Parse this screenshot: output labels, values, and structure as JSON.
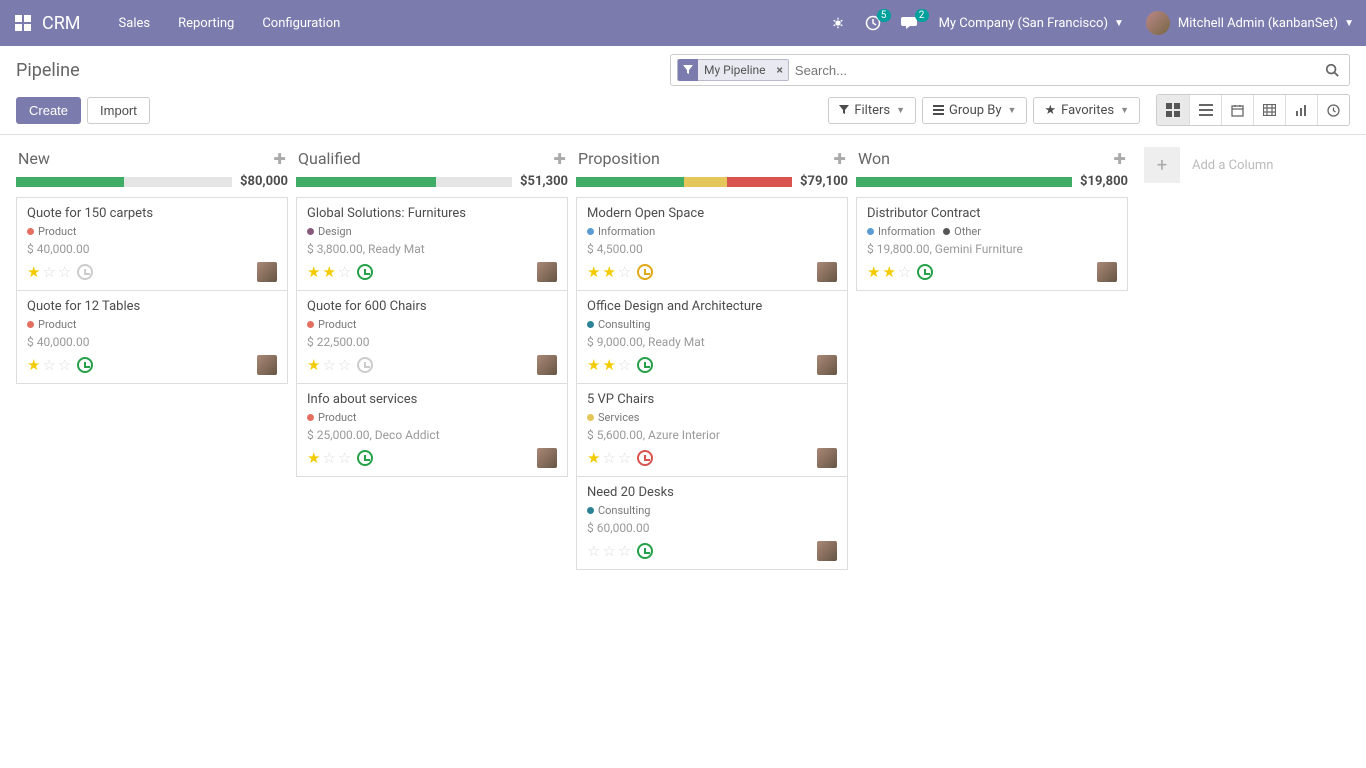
{
  "navbar": {
    "brand": "CRM",
    "menu": [
      "Sales",
      "Reporting",
      "Configuration"
    ],
    "debug_badge": "5",
    "messages_badge": "2",
    "company": "My Company (San Francisco)",
    "user": "Mitchell Admin (kanbanSet)"
  },
  "page": {
    "title": "Pipeline",
    "search_facet": "My Pipeline",
    "search_placeholder": "Search...",
    "create_label": "Create",
    "import_label": "Import",
    "filters_label": "Filters",
    "groupby_label": "Group By",
    "favorites_label": "Favorites"
  },
  "tag_colors": {
    "Product": "#e46f61",
    "Design": "#875a7b",
    "Information": "#5b9bd1",
    "Consulting": "#2c8397",
    "Services": "#e4c65b",
    "Other": "#555"
  },
  "columns": [
    {
      "title": "New",
      "total": "$80,000",
      "bar": [
        {
          "color": "#40ad67",
          "pct": 50
        }
      ],
      "cards": [
        {
          "title": "Quote for 150 carpets",
          "tags": [
            "Product"
          ],
          "sub": "$ 40,000.00",
          "stars": 1,
          "activity": "none"
        },
        {
          "title": "Quote for 12 Tables",
          "tags": [
            "Product"
          ],
          "sub": "$ 40,000.00",
          "stars": 1,
          "activity": "green"
        }
      ]
    },
    {
      "title": "Qualified",
      "total": "$51,300",
      "bar": [
        {
          "color": "#40ad67",
          "pct": 65
        }
      ],
      "cards": [
        {
          "title": "Global Solutions: Furnitures",
          "tags": [
            "Design"
          ],
          "sub": "$ 3,800.00, Ready Mat",
          "stars": 2,
          "activity": "green"
        },
        {
          "title": "Quote for 600 Chairs",
          "tags": [
            "Product"
          ],
          "sub": "$ 22,500.00",
          "stars": 1,
          "activity": "none"
        },
        {
          "title": "Info about services",
          "tags": [
            "Product"
          ],
          "sub": "$ 25,000.00, Deco Addict",
          "stars": 1,
          "activity": "green"
        }
      ]
    },
    {
      "title": "Proposition",
      "total": "$79,100",
      "bar": [
        {
          "color": "#40ad67",
          "pct": 50
        },
        {
          "color": "#e4c65b",
          "pct": 20
        },
        {
          "color": "#d9534f",
          "pct": 30
        }
      ],
      "cards": [
        {
          "title": "Modern Open Space",
          "tags": [
            "Information"
          ],
          "sub": "$ 4,500.00",
          "stars": 2,
          "activity": "orange"
        },
        {
          "title": "Office Design and Architecture",
          "tags": [
            "Consulting"
          ],
          "sub": "$ 9,000.00, Ready Mat",
          "stars": 2,
          "activity": "green"
        },
        {
          "title": "5 VP Chairs",
          "tags": [
            "Services"
          ],
          "sub": "$ 5,600.00, Azure Interior",
          "stars": 1,
          "activity": "red"
        },
        {
          "title": "Need 20 Desks",
          "tags": [
            "Consulting"
          ],
          "sub": "$ 60,000.00",
          "stars": 0,
          "activity": "green"
        }
      ]
    },
    {
      "title": "Won",
      "total": "$19,800",
      "bar": [
        {
          "color": "#40ad67",
          "pct": 100
        }
      ],
      "cards": [
        {
          "title": "Distributor Contract",
          "tags": [
            "Information",
            "Other"
          ],
          "sub": "$ 19,800.00, Gemini Furniture",
          "stars": 2,
          "activity": "green"
        }
      ]
    }
  ],
  "add_column_label": "Add a Column"
}
